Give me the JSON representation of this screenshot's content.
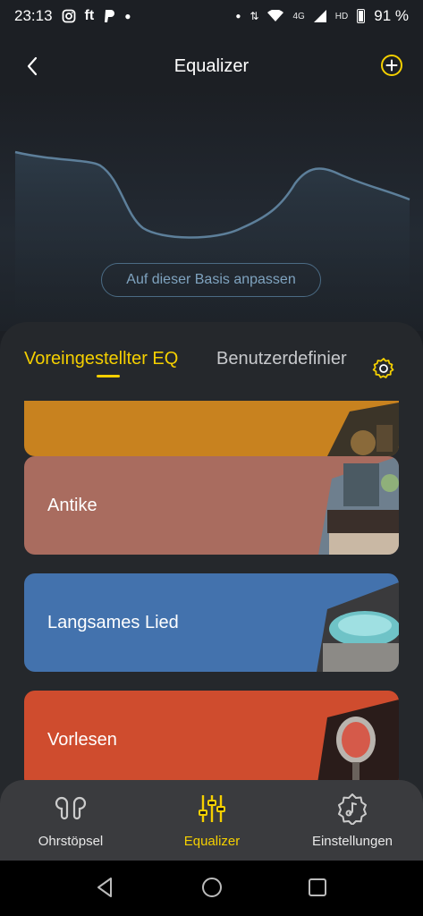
{
  "status_bar": {
    "time": "23:13",
    "app_icons": [
      "instagram-icon",
      "ft-icon",
      "paypal-icon"
    ],
    "ft_text": "ft",
    "network": "4G",
    "hd": "HD",
    "battery": "91 %"
  },
  "header": {
    "title": "Equalizer",
    "back_icon": "chevron-left-icon",
    "add_icon": "plus-circle-icon"
  },
  "curve": {
    "button_label": "Auf dieser Basis anpassen",
    "line_color": "#5d7f9a"
  },
  "tabs": {
    "preset_label": "Voreingestellter EQ",
    "custom_label": "Benutzerdefinier",
    "active_color": "#f5d000"
  },
  "presets": [
    {
      "label": "",
      "color": "#c8821f"
    },
    {
      "label": "Antike",
      "color": "#a96c5f"
    },
    {
      "label": "Langsames Lied",
      "color": "#4372ad"
    },
    {
      "label": "Vorlesen",
      "color": "#cf4c2e"
    }
  ],
  "bottom_nav": {
    "items": [
      {
        "label": "Ohrstöpsel",
        "icon": "earbuds-icon"
      },
      {
        "label": "Equalizer",
        "icon": "sliders-icon",
        "active": true
      },
      {
        "label": "Einstellungen",
        "icon": "settings-icon"
      }
    ]
  },
  "system_nav": [
    "back-triangle-icon",
    "home-circle-icon",
    "recents-square-icon"
  ]
}
